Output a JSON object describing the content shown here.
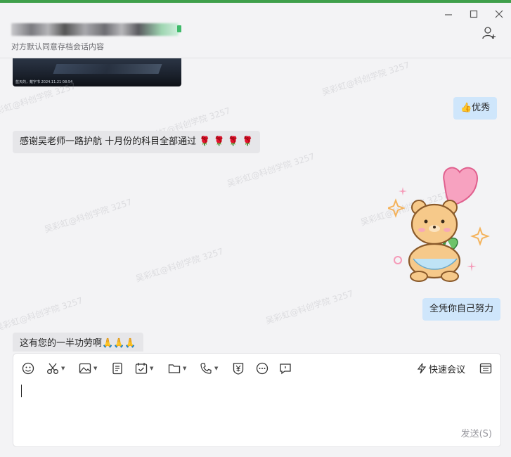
{
  "window": {
    "contact_name_blurred": true,
    "subtitle": "对方默认同意存档会话内容",
    "controls": [
      "minimize-icon",
      "maximize-icon",
      "close-icon"
    ],
    "add_contact_icon": "add-person-icon"
  },
  "chat": {
    "video_caption": "蓝天的，戴字书  2024.11.21 08:54",
    "messages": [
      {
        "side": "out",
        "text": "👍优秀"
      },
      {
        "side": "in",
        "text": "感谢吴老师一路护航 十月份的科目全部通过 🌹 🌹 🌹 🌹"
      },
      {
        "side": "out",
        "type": "sticker",
        "icon": "bear-holding-flower-sticker"
      },
      {
        "side": "out",
        "text": "全凭你自己努力"
      },
      {
        "side": "in",
        "text": "这有您的一半功劳啊🙏🙏🙏"
      }
    ],
    "watermark": "吴彩虹@科创学院 3257"
  },
  "composer": {
    "tools": [
      "emoji-icon",
      "scissors-icon",
      "image-icon",
      "document-icon",
      "calendar-check-icon",
      "folder-icon",
      "phone-icon",
      "red-packet-icon",
      "more-icon",
      "chat-icon"
    ],
    "quick_meeting": "快速会议",
    "send_label": "发送(S)"
  },
  "colors": {
    "accent_green": "#3f9f4b",
    "out_bubble": "#cfe6fb",
    "in_bubble": "#e6e6e9"
  }
}
